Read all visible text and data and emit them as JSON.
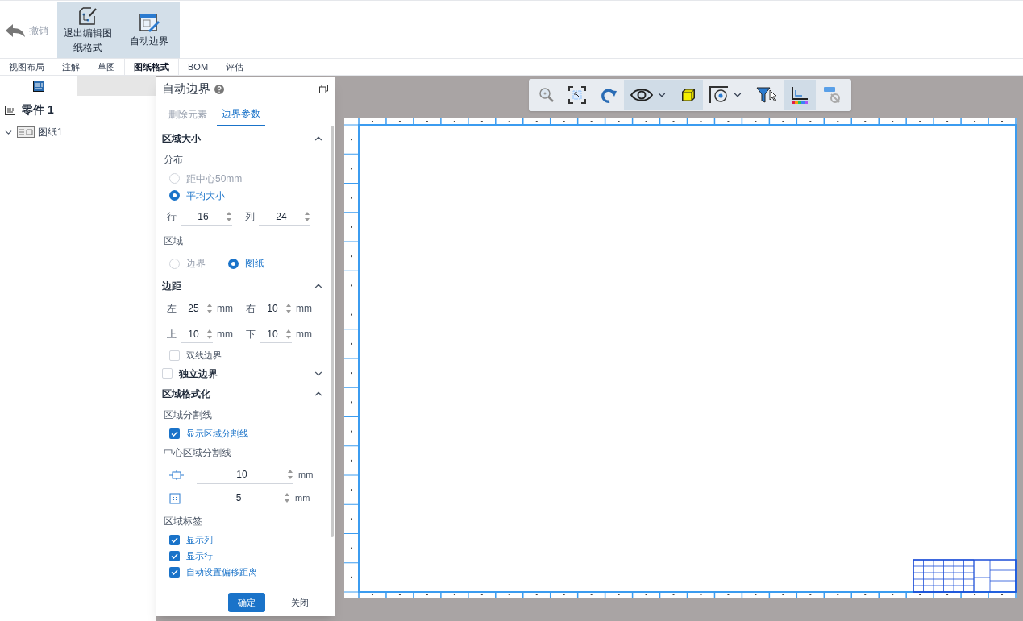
{
  "ribbon": {
    "buttons": [
      {
        "kind": "undo",
        "label": "撤销",
        "disabled": true,
        "selected": false
      },
      {
        "kind": "exit",
        "label": "退出编辑图纸格式",
        "disabled": false,
        "selected": true
      },
      {
        "kind": "border",
        "label": "自动边界",
        "disabled": false,
        "selected": true
      }
    ]
  },
  "tabs": [
    {
      "label": "视图布局",
      "selected": false
    },
    {
      "label": "注解",
      "selected": false
    },
    {
      "label": "草图",
      "selected": false
    },
    {
      "label": "图纸格式",
      "selected": true
    },
    {
      "label": "BOM",
      "selected": false
    },
    {
      "label": "评估",
      "selected": false
    }
  ],
  "sidebar": {
    "root": "零件 1",
    "items": [
      {
        "label": "图纸1",
        "expanded": true
      }
    ]
  },
  "panel": {
    "title": "自动边界",
    "tabs": [
      {
        "label": "删除元素",
        "selected": false
      },
      {
        "label": "边界参数",
        "selected": true
      }
    ],
    "sections": [
      {
        "title": "区域大小",
        "expanded": true,
        "rows": [
          {
            "kind": "label",
            "text": "分布"
          },
          {
            "kind": "radio",
            "text": "距中心50mm",
            "selected": false
          },
          {
            "kind": "radio",
            "text": "平均大小",
            "selected": true
          },
          {
            "kind": "spin_pair",
            "fields": [
              {
                "label": "行",
                "value": "16"
              },
              {
                "label": "列",
                "value": "24"
              }
            ]
          },
          {
            "kind": "label",
            "text": "区域"
          },
          {
            "kind": "radio_row",
            "options": [
              {
                "text": "边界",
                "selected": false
              },
              {
                "text": "图纸",
                "selected": true
              }
            ]
          }
        ]
      },
      {
        "title": "边距",
        "expanded": true,
        "rows": [
          {
            "kind": "spin_pair",
            "fields": [
              {
                "label": "左",
                "value": "25",
                "unit": "mm"
              },
              {
                "label": "右",
                "value": "10",
                "unit": "mm"
              }
            ]
          },
          {
            "kind": "spin_pair",
            "fields": [
              {
                "label": "上",
                "value": "10",
                "unit": "mm"
              },
              {
                "label": "下",
                "value": "10",
                "unit": "mm"
              }
            ]
          },
          {
            "kind": "checkbox",
            "text": "双线边界",
            "checked": false
          }
        ]
      },
      {
        "title": "独立边界",
        "expanded": false,
        "checked": false
      },
      {
        "title": "区域格式化",
        "expanded": true,
        "rows": [
          {
            "kind": "label",
            "text": "区域分割线"
          },
          {
            "kind": "checkbox",
            "text": "显示区域分割线",
            "checked": true
          },
          {
            "kind": "label",
            "text": "中心区域分割线"
          },
          {
            "kind": "center_spin",
            "value": "10",
            "unit": "mm"
          },
          {
            "kind": "corner_spin",
            "value": "5",
            "unit": "mm"
          },
          {
            "kind": "label",
            "text": "区域标签"
          },
          {
            "kind": "checkbox",
            "text": "显示列",
            "checked": true
          },
          {
            "kind": "checkbox",
            "text": "显示行",
            "checked": true
          },
          {
            "kind": "checkbox",
            "text": "自动设置偏移距离",
            "checked": true
          }
        ]
      }
    ],
    "buttons": [
      {
        "label": "确定",
        "primary": true
      },
      {
        "label": "关闭",
        "primary": false
      }
    ]
  },
  "view_toolbar": [
    {
      "kind": "zoom",
      "selected": false
    },
    {
      "kind": "fit",
      "selected": false
    },
    {
      "kind": "rotate",
      "selected": false
    },
    {
      "kind": "eye",
      "selected": true
    },
    {
      "kind": "cube",
      "selected": true
    },
    {
      "kind": "section",
      "selected": false
    },
    {
      "kind": "filter",
      "selected": false
    },
    {
      "kind": "axes",
      "selected": true
    },
    {
      "kind": "label",
      "selected": false
    }
  ]
}
